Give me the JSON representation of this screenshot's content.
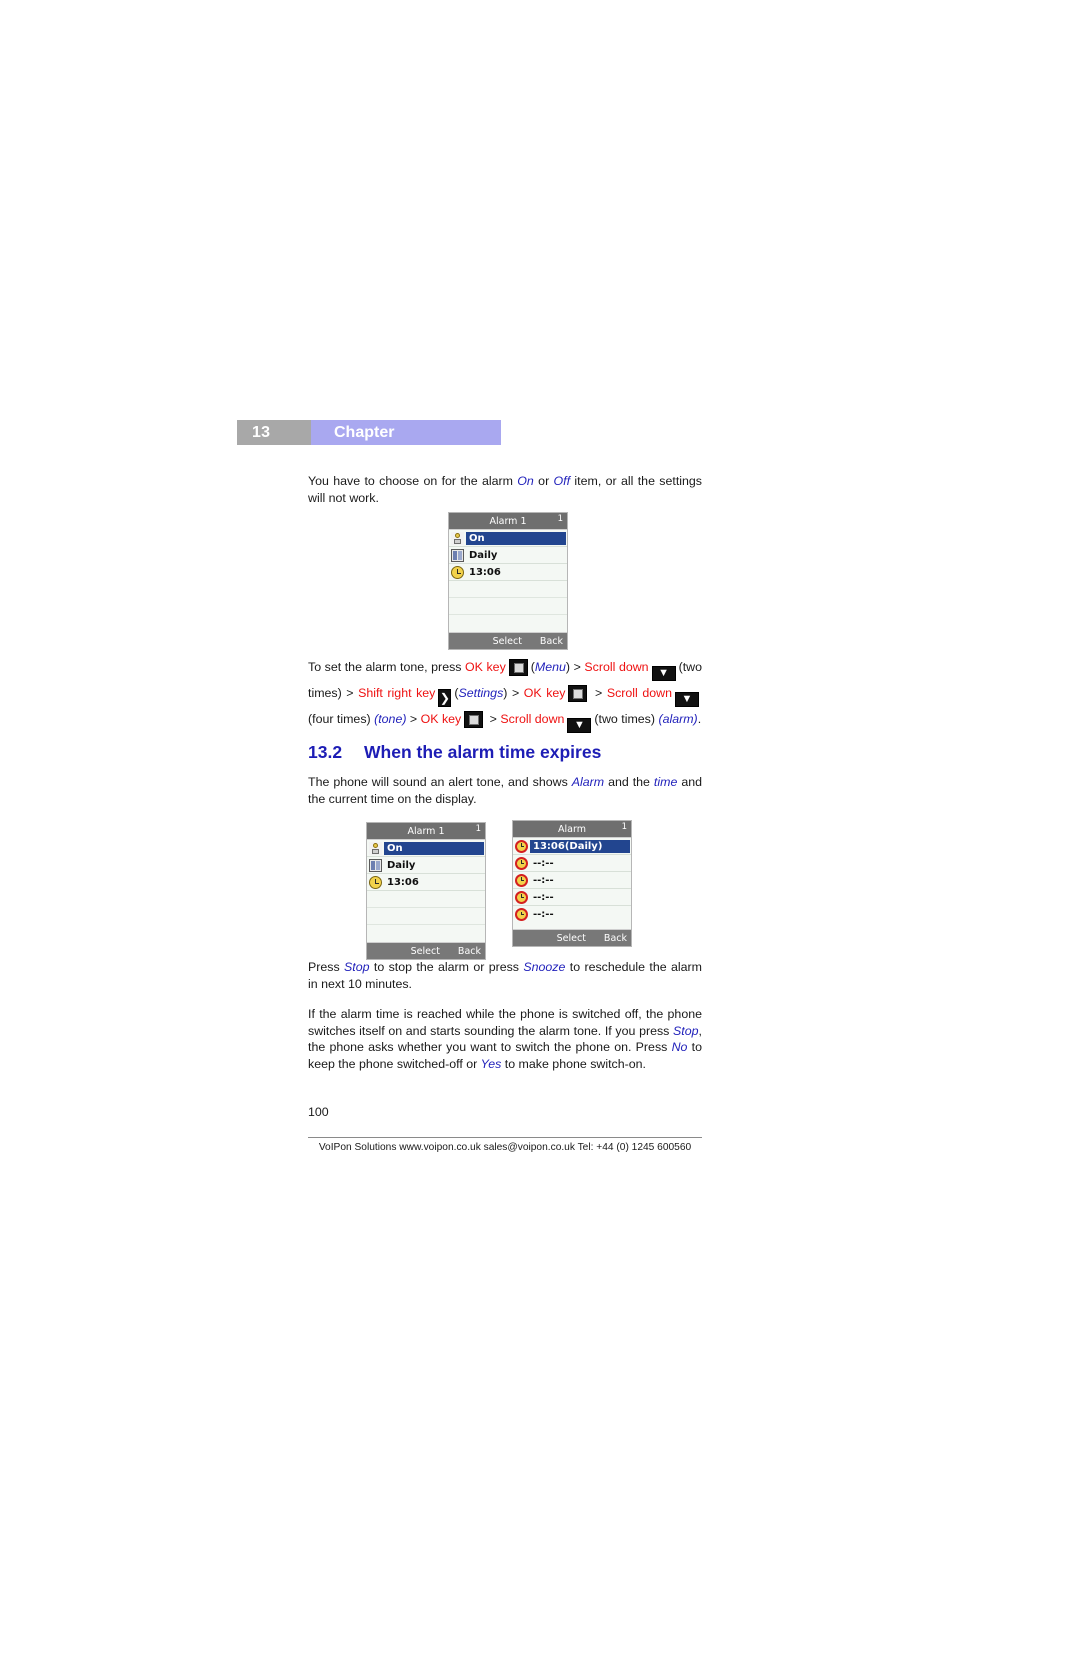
{
  "chapter": {
    "number": "13",
    "label": "Chapter",
    "num_bg": "#a8a8a8",
    "title_bg": "#a9a8f0"
  },
  "paragraphs": {
    "intro_1": "You have to choose on for the alarm ",
    "intro_on": "On",
    "intro_2": " or ",
    "intro_off": "Off",
    "intro_3": " item, or all the settings will not work.",
    "steps_1": "To set the alarm tone, press ",
    "steps_ok1": "OK key",
    "steps_menu": "Menu",
    "steps_scroll1": "Scroll down",
    "steps_two1": "(two times) > ",
    "steps_shift": "Shift right key",
    "steps_settings": "Settings",
    "steps_ok2": "OK key",
    "steps_scroll2": "Scroll down",
    "steps_four": "(four times) ",
    "steps_tone": "(tone)",
    "steps_gt1": " > ",
    "steps_ok3": "OK key",
    "steps_scroll3": "Scroll down",
    "steps_two2": "(two times) ",
    "steps_alarm": "(alarm)",
    "steps_period": ".",
    "expires_1": "The phone will sound an alert tone, and shows ",
    "expires_alarm": "Alarm",
    "expires_2": " and the ",
    "expires_time": "time",
    "expires_3": " and the current time on the display.",
    "press_1": "Press ",
    "press_stop": "Stop",
    "press_2": " to stop the alarm or press ",
    "press_snooze": "Snooze",
    "press_3": " to reschedule the alarm in next 10 minutes.",
    "reached_1": "If the alarm time is reached while the phone is switched off, the phone switches itself on and starts sounding the alarm tone. If you press ",
    "reached_stop": "Stop",
    "reached_2": ", the phone asks whether you want to switch the phone on. Press ",
    "reached_no": "No",
    "reached_3": " to keep the phone switched-off or ",
    "reached_yes": "Yes",
    "reached_4": " to make phone switch-on."
  },
  "section": {
    "number": "13.2",
    "title": "When the alarm time expires",
    "color": "#1d1db5"
  },
  "screens": {
    "alarm_settings_1": {
      "title": "Alarm 1",
      "index": "1",
      "rows": [
        {
          "icon": "person-icon",
          "label": "On",
          "selected": true
        },
        {
          "icon": "calendar-icon",
          "label": "Daily",
          "selected": false
        },
        {
          "icon": "clock-icon",
          "label": "13:06",
          "selected": false
        }
      ],
      "softkey_left": "Select",
      "softkey_right": "Back"
    },
    "alarm_settings_2": {
      "title": "Alarm 1",
      "index": "1",
      "rows": [
        {
          "icon": "person-icon",
          "label": "On",
          "selected": true
        },
        {
          "icon": "calendar-icon",
          "label": "Daily",
          "selected": false
        },
        {
          "icon": "clock-icon",
          "label": "13:06",
          "selected": false
        }
      ],
      "softkey_left": "Select",
      "softkey_right": "Back"
    },
    "alarm_list": {
      "title": "Alarm",
      "index": "1",
      "rows": [
        {
          "icon": "red-alarm-clock-icon",
          "label": "13:06(Daily)",
          "selected": true
        },
        {
          "icon": "red-alarm-clock-icon",
          "label": "--:--",
          "selected": false
        },
        {
          "icon": "red-alarm-clock-icon",
          "label": "--:--",
          "selected": false
        },
        {
          "icon": "red-alarm-clock-icon",
          "label": "--:--",
          "selected": false
        },
        {
          "icon": "red-alarm-clock-icon",
          "label": "--:--",
          "selected": false
        }
      ],
      "softkey_left": "Select",
      "softkey_right": "Back"
    }
  },
  "keys": {
    "ok_key_glyph": "ok-key-icon",
    "scroll_down_glyph": "▼",
    "shift_right_glyph": "❯"
  },
  "footer": {
    "page_number": "100",
    "credit": "VoIPon Solutions www.voipon.co.uk sales@voipon.co.uk Tel: +44 (0) 1245 600560"
  }
}
